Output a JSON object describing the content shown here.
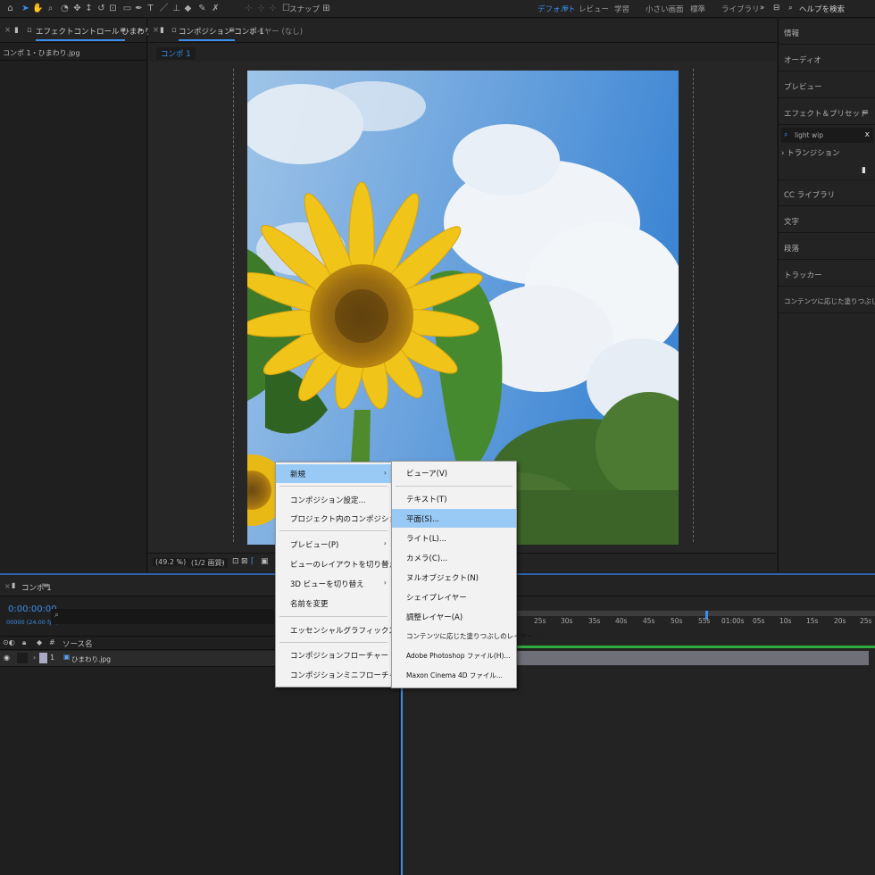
{
  "toolbar": {
    "snap_label": "スナップ",
    "workspaces": [
      "デフォルト",
      "レビュー",
      "学習",
      "小さい画面",
      "標準",
      "ライブラリ"
    ],
    "help_search": "ヘルプを検索"
  },
  "left_panel": {
    "tab_title": "エフェクトコントロール ひまわり.jpg",
    "breadcrumb": "コンポ 1・ひまわり.jpg"
  },
  "comp_panel": {
    "tab_title": "コンポジション コンポ 1",
    "layer_tab": "レイヤー (なし)",
    "comp_chip": "コンポ 1",
    "zoom": "(49.2 %)",
    "resolution": "(1/2 画質)"
  },
  "right_panel": {
    "items": [
      "情報",
      "オーディオ",
      "プレビュー",
      "エフェクト＆プリセット"
    ],
    "search_value": "light wip",
    "transition": "トランジション",
    "items2": [
      "CC ライブラリ",
      "文字",
      "段落",
      "トラッカー",
      "コンテンツに応じた塗りつぶし"
    ]
  },
  "timeline": {
    "comp_tab": "コンポ 1",
    "timecode": "0:00:00:00",
    "fps": "00000 (24.00 fps)",
    "source_header": "ソース名",
    "layer_number": "1",
    "layer_name": "ひまわり.jpg",
    "ruler": [
      "25s",
      "30s",
      "35s",
      "40s",
      "45s",
      "50s",
      "55s",
      "01:00s",
      "05s",
      "10s",
      "15s",
      "20s",
      "25s"
    ]
  },
  "context_menu": {
    "items": [
      "新規",
      "コンポジション設定...",
      "プロジェクト内のコンポジションを表示",
      "プレビュー(P)",
      "ビューのレイアウトを切り替え",
      "3D ビューを切り替え",
      "名前を変更",
      "エッセンシャルグラフィックスで開く",
      "コンポジションフローチャート",
      "コンポジションミニフローチャート"
    ]
  },
  "submenu": {
    "items": [
      "ビューア(V)",
      "テキスト(T)",
      "平面(S)...",
      "ライト(L)...",
      "カメラ(C)...",
      "ヌルオブジェクト(N)",
      "シェイプレイヤー",
      "調整レイヤー(A)",
      "コンテンツに応じた塗りつぶしのレイヤー...",
      "Adobe Photoshop ファイル(H)...",
      "Maxon Cinema 4D ファイル..."
    ]
  },
  "colors": {
    "accent": "#3b8eea",
    "menu_highlight": "#99c9f5",
    "timeline_bar": "#6f6f78"
  }
}
